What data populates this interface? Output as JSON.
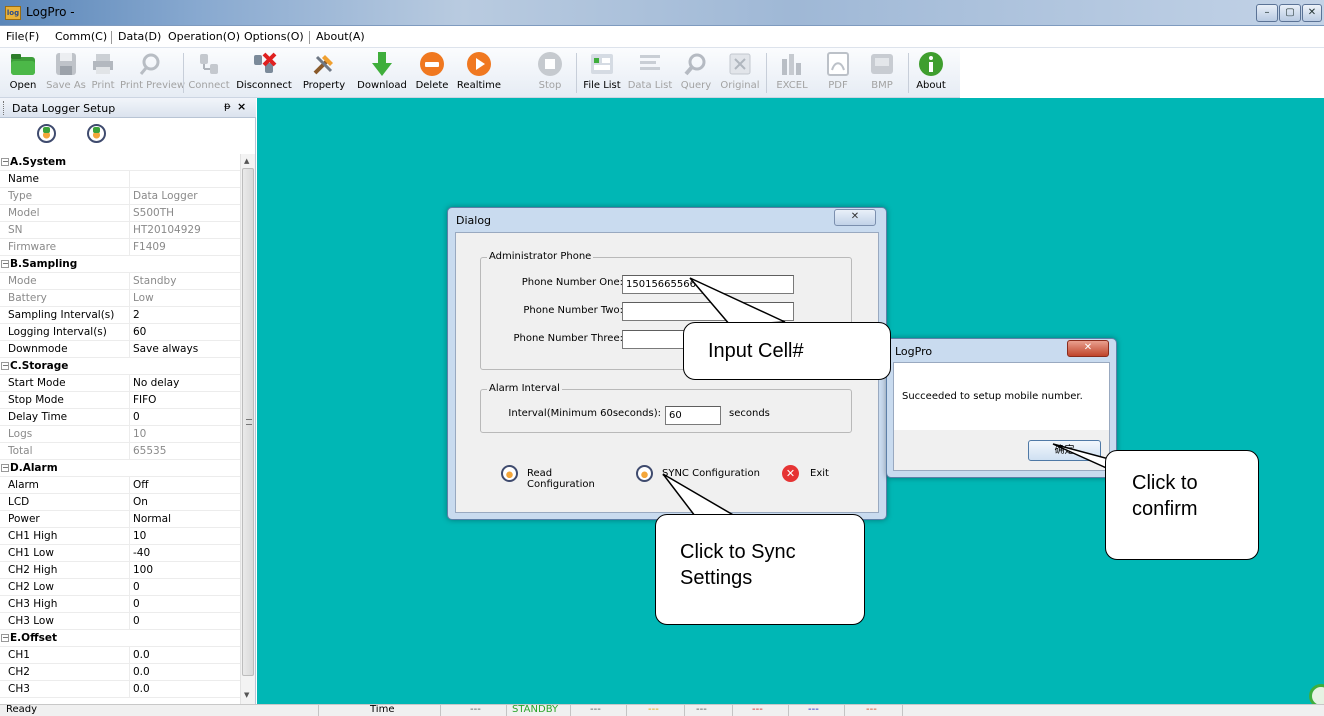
{
  "window": {
    "title": "LogPro -",
    "icon_label": "log",
    "btn_min": "–",
    "btn_max": "▢",
    "btn_close": "✕"
  },
  "menu": [
    "File(F)",
    "Comm(C)",
    "Data(D)",
    "Operation(O)",
    "Options(O)",
    "About(A)"
  ],
  "toolbar": [
    {
      "label": "Open",
      "icon": "folder-open-icon",
      "enabled": true
    },
    {
      "label": "Save As",
      "icon": "save-icon",
      "enabled": false
    },
    {
      "label": "Print",
      "icon": "print-icon",
      "enabled": false
    },
    {
      "label": "Print Preview",
      "icon": "print-preview-icon",
      "enabled": false
    },
    {
      "label": "Connect",
      "icon": "connect-icon",
      "enabled": false
    },
    {
      "label": "Disconnect",
      "icon": "disconnect-icon",
      "enabled": true
    },
    {
      "label": "Property",
      "icon": "property-tools-icon",
      "enabled": true
    },
    {
      "label": "Download",
      "icon": "download-arrow-icon",
      "enabled": true
    },
    {
      "label": "Delete",
      "icon": "delete-icon",
      "enabled": true
    },
    {
      "label": "Realtime",
      "icon": "realtime-play-icon",
      "enabled": true
    },
    {
      "label": "Stop",
      "icon": "stop-icon",
      "enabled": false
    },
    {
      "label": "File List",
      "icon": "file-list-icon",
      "enabled": true
    },
    {
      "label": "Data List",
      "icon": "data-list-icon",
      "enabled": false
    },
    {
      "label": "Query",
      "icon": "query-magnifier-icon",
      "enabled": false
    },
    {
      "label": "Original",
      "icon": "original-zoom-icon",
      "enabled": false
    },
    {
      "label": "EXCEL",
      "icon": "excel-chart-icon",
      "enabled": false
    },
    {
      "label": "PDF",
      "icon": "pdf-icon",
      "enabled": false
    },
    {
      "label": "BMP",
      "icon": "bmp-image-icon",
      "enabled": false
    },
    {
      "label": "About",
      "icon": "info-icon",
      "enabled": true
    }
  ],
  "panel": {
    "title": "Data Logger Setup",
    "pin": "ᵽ",
    "close": "×",
    "sections": [
      {
        "title": "A.System",
        "rows": [
          {
            "key": "Name",
            "value": "",
            "grey": false
          },
          {
            "key": "Type",
            "value": "Data Logger",
            "grey": true
          },
          {
            "key": "Model",
            "value": "S500TH",
            "grey": true
          },
          {
            "key": "SN",
            "value": "HT20104929",
            "grey": true
          },
          {
            "key": "Firmware",
            "value": "F1409",
            "grey": true
          }
        ]
      },
      {
        "title": "B.Sampling",
        "rows": [
          {
            "key": "Mode",
            "value": "Standby",
            "grey": true
          },
          {
            "key": "Battery",
            "value": "Low",
            "grey": true
          },
          {
            "key": "Sampling Interval(s)",
            "value": "2",
            "grey": false
          },
          {
            "key": "Logging Interval(s)",
            "value": "60",
            "grey": false
          },
          {
            "key": "Downmode",
            "value": "Save always",
            "grey": false
          }
        ]
      },
      {
        "title": "C.Storage",
        "rows": [
          {
            "key": "Start Mode",
            "value": "No delay",
            "grey": false
          },
          {
            "key": "Stop Mode",
            "value": "FIFO",
            "grey": false
          },
          {
            "key": "Delay Time",
            "value": "0",
            "grey": false
          },
          {
            "key": "Logs",
            "value": "10",
            "grey": true
          },
          {
            "key": "Total",
            "value": "65535",
            "grey": true
          }
        ]
      },
      {
        "title": "D.Alarm",
        "rows": [
          {
            "key": "Alarm",
            "value": "Off",
            "grey": false
          },
          {
            "key": "LCD",
            "value": "On",
            "grey": false
          },
          {
            "key": "Power",
            "value": "Normal",
            "grey": false
          },
          {
            "key": "CH1 High",
            "value": "10",
            "grey": false
          },
          {
            "key": "CH1 Low",
            "value": "-40",
            "grey": false
          },
          {
            "key": "CH2 High",
            "value": "100",
            "grey": false
          },
          {
            "key": "CH2 Low",
            "value": "0",
            "grey": false
          },
          {
            "key": "CH3 High",
            "value": "0",
            "grey": false
          },
          {
            "key": "CH3 Low",
            "value": "0",
            "grey": false
          }
        ]
      },
      {
        "title": "E.Offset",
        "rows": [
          {
            "key": "CH1",
            "value": "0.0",
            "grey": false
          },
          {
            "key": "CH2",
            "value": "0.0",
            "grey": false
          },
          {
            "key": "CH3",
            "value": "0.0",
            "grey": false
          }
        ]
      }
    ]
  },
  "dialog": {
    "title": "Dialog",
    "close": "✕",
    "admin_group": "Administrator Phone",
    "phone_one_label": "Phone Number One:",
    "phone_one_value": "15015665566",
    "phone_two_label": "Phone Number Two:",
    "phone_two_value": "",
    "phone_three_label": "Phone Number Three:",
    "phone_three_value": "",
    "alarm_group": "Alarm Interval",
    "interval_label": "Interval(Minimum 60seconds):",
    "interval_value": "60",
    "interval_unit": "seconds",
    "read_btn": "Read Configuration",
    "sync_btn": "SYNC Configuration",
    "exit_btn": "Exit"
  },
  "msgbox": {
    "title": "LogPro",
    "close": "✕",
    "message": "Succeeded to setup mobile number.",
    "ok": "确定"
  },
  "callouts": {
    "input": "Input Cell#",
    "sync_line1": "Click to Sync",
    "sync_line2": "Settings",
    "confirm_line1": "Click to",
    "confirm_line2": "confirm"
  },
  "status": {
    "ready": "Ready",
    "time": "Time",
    "cells": [
      {
        "text": "---",
        "color": "#555555"
      },
      {
        "text": "STANDBY",
        "color": "#2aa52a"
      },
      {
        "text": "---",
        "color": "#555555"
      },
      {
        "text": "---",
        "color": "#e0a000"
      },
      {
        "text": "---",
        "color": "#555555"
      },
      {
        "text": "---",
        "color": "#d02020"
      },
      {
        "text": "---",
        "color": "#2020c0"
      },
      {
        "text": "---",
        "color": "#d04020"
      }
    ]
  }
}
